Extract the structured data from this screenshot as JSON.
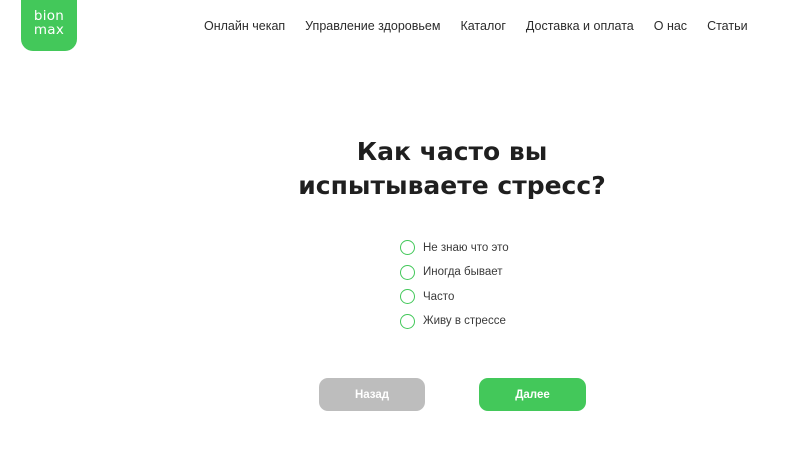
{
  "logo": {
    "line1": "bion",
    "line2": "max"
  },
  "nav": {
    "items": [
      {
        "label": "Онлайн чекап"
      },
      {
        "label": "Управление здоровьем"
      },
      {
        "label": "Каталог"
      },
      {
        "label": "Доставка и оплата"
      },
      {
        "label": "О нас"
      },
      {
        "label": "Статьи"
      }
    ]
  },
  "quiz": {
    "question": "Как часто вы испытываете стресс?",
    "options": [
      {
        "label": "Не знаю что это",
        "selected": false
      },
      {
        "label": "Иногда бывает",
        "selected": false
      },
      {
        "label": "Часто",
        "selected": false
      },
      {
        "label": "Живу в стрессе",
        "selected": false
      }
    ],
    "back_label": "Назад",
    "next_label": "Далее"
  },
  "colors": {
    "accent": "#43c85a",
    "disabled": "#bdbdbd"
  }
}
